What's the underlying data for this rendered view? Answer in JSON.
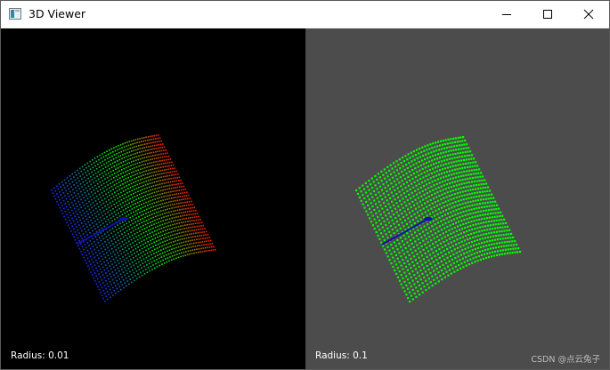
{
  "window": {
    "title": "3D Viewer",
    "controls": {
      "minimize_icon": "minimize-icon",
      "maximize_icon": "maximize-icon",
      "close_icon": "close-icon"
    }
  },
  "viewports": {
    "left": {
      "label": "Radius: 0.01",
      "background": "#000000",
      "coloring": "height-gradient",
      "gradient_colors": [
        "#1a2cff",
        "#00ff00",
        "#ff1a00"
      ]
    },
    "right": {
      "label": "Radius: 0.1",
      "background": "#4c4c4c",
      "point_color": "#00ff00"
    }
  },
  "watermark": "CSDN @点云兔子",
  "colors": {
    "axis_blue": "#1010b0",
    "point_green": "#00ff00"
  }
}
